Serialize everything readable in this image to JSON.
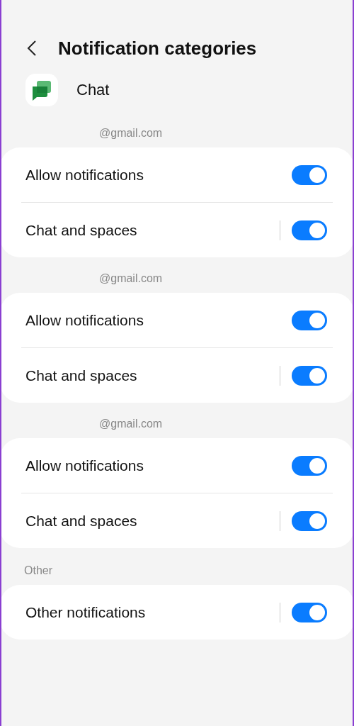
{
  "header": {
    "title": "Notification categories"
  },
  "app": {
    "name": "Chat"
  },
  "sections": [
    {
      "title": "@gmail.com",
      "items": [
        {
          "label": "Allow notifications",
          "on": true,
          "split": false
        },
        {
          "label": "Chat and spaces",
          "on": true,
          "split": true
        }
      ]
    },
    {
      "title": "@gmail.com",
      "items": [
        {
          "label": "Allow notifications",
          "on": true,
          "split": false
        },
        {
          "label": "Chat and spaces",
          "on": true,
          "split": true
        }
      ]
    },
    {
      "title": "@gmail.com",
      "items": [
        {
          "label": "Allow notifications",
          "on": true,
          "split": false
        },
        {
          "label": "Chat and spaces",
          "on": true,
          "split": true
        }
      ]
    },
    {
      "title": "Other",
      "items": [
        {
          "label": "Other notifications",
          "on": true,
          "split": true
        }
      ]
    }
  ]
}
